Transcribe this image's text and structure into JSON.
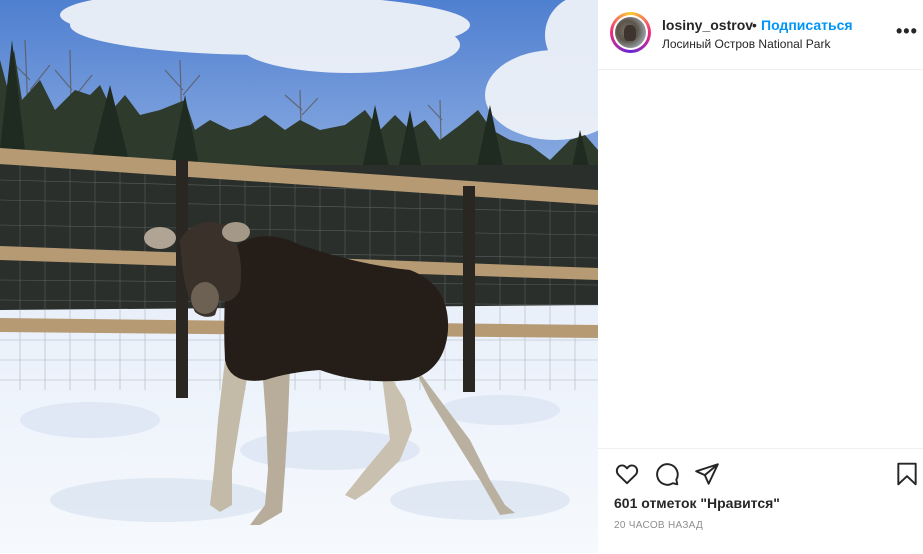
{
  "post": {
    "image": {
      "description_icon": "moose-photo"
    },
    "header": {
      "username": "losiny_ostrov",
      "separator": "•",
      "follow_label": "Подписаться",
      "location": "Лосиный Остров National Park",
      "more_icon": "more-options-icon",
      "more_label": "..."
    },
    "actions": {
      "like_icon": "heart-icon",
      "comment_icon": "comment-icon",
      "share_icon": "share-icon",
      "save_icon": "bookmark-icon"
    },
    "likes_text": "601 отметок \"Нравится\"",
    "timestamp": "20 ЧАСОВ НАЗАД"
  },
  "colors": {
    "accent": "#0095f6",
    "text": "#262626",
    "muted": "#8e8e8e",
    "border": "#efefef"
  }
}
